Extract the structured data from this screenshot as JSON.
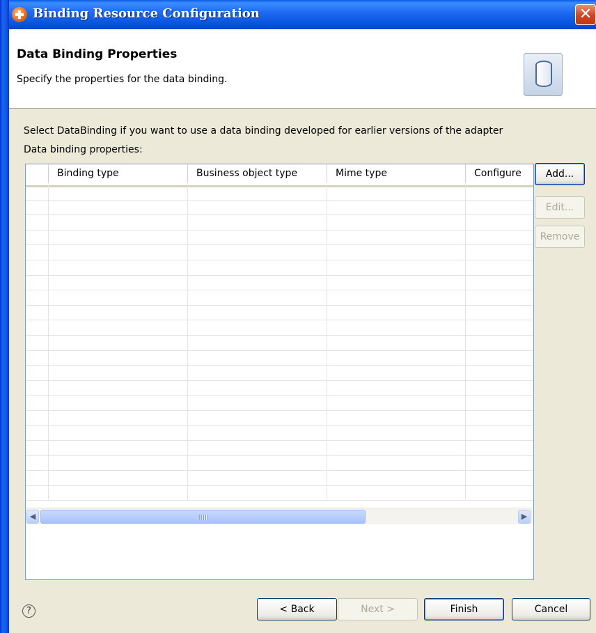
{
  "window": {
    "title": "Binding Resource Configuration",
    "close_glyph": "✕"
  },
  "header": {
    "title": "Data Binding Properties",
    "description": "Specify the properties for the data binding.",
    "icon": "database-icon"
  },
  "content": {
    "instruction": "Select DataBinding if you want to use a data binding developed for earlier versions of the adapter",
    "table_label": "Data binding properties:",
    "columns": [
      "",
      "Binding type",
      "Business object type",
      "Mime type",
      "Configure"
    ],
    "rows": [],
    "scroll_thumb_glyph": "|||"
  },
  "side_buttons": {
    "add": "Add...",
    "edit": "Edit...",
    "remove": "Remove"
  },
  "footer": {
    "help_glyph": "?",
    "back": "< Back",
    "next": "Next >",
    "finish": "Finish",
    "cancel": "Cancel"
  }
}
